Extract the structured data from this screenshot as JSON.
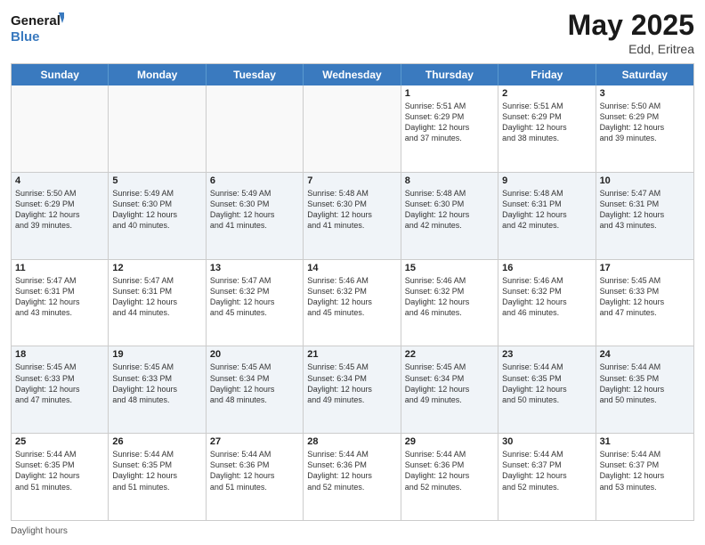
{
  "header": {
    "logo_general": "General",
    "logo_blue": "Blue",
    "month": "May 2025",
    "location": "Edd, Eritrea"
  },
  "days_of_week": [
    "Sunday",
    "Monday",
    "Tuesday",
    "Wednesday",
    "Thursday",
    "Friday",
    "Saturday"
  ],
  "weeks": [
    [
      {
        "day": "",
        "info": ""
      },
      {
        "day": "",
        "info": ""
      },
      {
        "day": "",
        "info": ""
      },
      {
        "day": "",
        "info": ""
      },
      {
        "day": "1",
        "info": "Sunrise: 5:51 AM\nSunset: 6:29 PM\nDaylight: 12 hours\nand 37 minutes."
      },
      {
        "day": "2",
        "info": "Sunrise: 5:51 AM\nSunset: 6:29 PM\nDaylight: 12 hours\nand 38 minutes."
      },
      {
        "day": "3",
        "info": "Sunrise: 5:50 AM\nSunset: 6:29 PM\nDaylight: 12 hours\nand 39 minutes."
      }
    ],
    [
      {
        "day": "4",
        "info": "Sunrise: 5:50 AM\nSunset: 6:29 PM\nDaylight: 12 hours\nand 39 minutes."
      },
      {
        "day": "5",
        "info": "Sunrise: 5:49 AM\nSunset: 6:30 PM\nDaylight: 12 hours\nand 40 minutes."
      },
      {
        "day": "6",
        "info": "Sunrise: 5:49 AM\nSunset: 6:30 PM\nDaylight: 12 hours\nand 41 minutes."
      },
      {
        "day": "7",
        "info": "Sunrise: 5:48 AM\nSunset: 6:30 PM\nDaylight: 12 hours\nand 41 minutes."
      },
      {
        "day": "8",
        "info": "Sunrise: 5:48 AM\nSunset: 6:30 PM\nDaylight: 12 hours\nand 42 minutes."
      },
      {
        "day": "9",
        "info": "Sunrise: 5:48 AM\nSunset: 6:31 PM\nDaylight: 12 hours\nand 42 minutes."
      },
      {
        "day": "10",
        "info": "Sunrise: 5:47 AM\nSunset: 6:31 PM\nDaylight: 12 hours\nand 43 minutes."
      }
    ],
    [
      {
        "day": "11",
        "info": "Sunrise: 5:47 AM\nSunset: 6:31 PM\nDaylight: 12 hours\nand 43 minutes."
      },
      {
        "day": "12",
        "info": "Sunrise: 5:47 AM\nSunset: 6:31 PM\nDaylight: 12 hours\nand 44 minutes."
      },
      {
        "day": "13",
        "info": "Sunrise: 5:47 AM\nSunset: 6:32 PM\nDaylight: 12 hours\nand 45 minutes."
      },
      {
        "day": "14",
        "info": "Sunrise: 5:46 AM\nSunset: 6:32 PM\nDaylight: 12 hours\nand 45 minutes."
      },
      {
        "day": "15",
        "info": "Sunrise: 5:46 AM\nSunset: 6:32 PM\nDaylight: 12 hours\nand 46 minutes."
      },
      {
        "day": "16",
        "info": "Sunrise: 5:46 AM\nSunset: 6:32 PM\nDaylight: 12 hours\nand 46 minutes."
      },
      {
        "day": "17",
        "info": "Sunrise: 5:45 AM\nSunset: 6:33 PM\nDaylight: 12 hours\nand 47 minutes."
      }
    ],
    [
      {
        "day": "18",
        "info": "Sunrise: 5:45 AM\nSunset: 6:33 PM\nDaylight: 12 hours\nand 47 minutes."
      },
      {
        "day": "19",
        "info": "Sunrise: 5:45 AM\nSunset: 6:33 PM\nDaylight: 12 hours\nand 48 minutes."
      },
      {
        "day": "20",
        "info": "Sunrise: 5:45 AM\nSunset: 6:34 PM\nDaylight: 12 hours\nand 48 minutes."
      },
      {
        "day": "21",
        "info": "Sunrise: 5:45 AM\nSunset: 6:34 PM\nDaylight: 12 hours\nand 49 minutes."
      },
      {
        "day": "22",
        "info": "Sunrise: 5:45 AM\nSunset: 6:34 PM\nDaylight: 12 hours\nand 49 minutes."
      },
      {
        "day": "23",
        "info": "Sunrise: 5:44 AM\nSunset: 6:35 PM\nDaylight: 12 hours\nand 50 minutes."
      },
      {
        "day": "24",
        "info": "Sunrise: 5:44 AM\nSunset: 6:35 PM\nDaylight: 12 hours\nand 50 minutes."
      }
    ],
    [
      {
        "day": "25",
        "info": "Sunrise: 5:44 AM\nSunset: 6:35 PM\nDaylight: 12 hours\nand 51 minutes."
      },
      {
        "day": "26",
        "info": "Sunrise: 5:44 AM\nSunset: 6:35 PM\nDaylight: 12 hours\nand 51 minutes."
      },
      {
        "day": "27",
        "info": "Sunrise: 5:44 AM\nSunset: 6:36 PM\nDaylight: 12 hours\nand 51 minutes."
      },
      {
        "day": "28",
        "info": "Sunrise: 5:44 AM\nSunset: 6:36 PM\nDaylight: 12 hours\nand 52 minutes."
      },
      {
        "day": "29",
        "info": "Sunrise: 5:44 AM\nSunset: 6:36 PM\nDaylight: 12 hours\nand 52 minutes."
      },
      {
        "day": "30",
        "info": "Sunrise: 5:44 AM\nSunset: 6:37 PM\nDaylight: 12 hours\nand 52 minutes."
      },
      {
        "day": "31",
        "info": "Sunrise: 5:44 AM\nSunset: 6:37 PM\nDaylight: 12 hours\nand 53 minutes."
      }
    ]
  ],
  "footer": {
    "daylight_label": "Daylight hours"
  }
}
